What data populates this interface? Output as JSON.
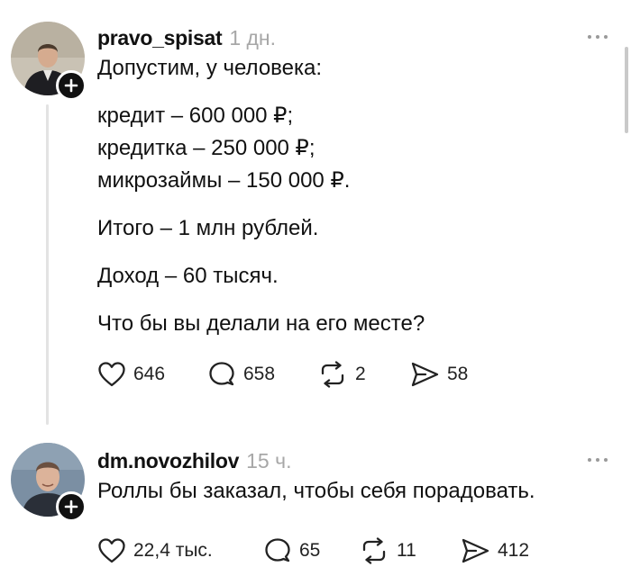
{
  "posts": [
    {
      "username": "pravo_spisat",
      "timestamp": "1 дн.",
      "lines": [
        "Допустим, у человека:",
        "",
        "кредит – 600 000 ₽;",
        "кредитка – 250 000 ₽;",
        "микрозаймы – 150 000 ₽.",
        "",
        "Итого – 1 млн рублей.",
        "",
        "Доход – 60 тысяч.",
        "",
        "Что бы вы делали на его месте?"
      ],
      "likes": "646",
      "replies": "658",
      "reposts": "2",
      "shares": "58"
    },
    {
      "username": "dm.novozhilov",
      "timestamp": "15 ч.",
      "lines": [
        "Роллы бы заказал, чтобы себя порадовать."
      ],
      "likes": "22,4 тыс.",
      "replies": "65",
      "reposts": "11",
      "shares": "412"
    }
  ],
  "icons": [
    "heart-icon",
    "comment-icon",
    "repost-icon",
    "share-icon",
    "plus-icon",
    "more-icon"
  ],
  "colors": {
    "text": "#111111",
    "muted": "#a7a7a7",
    "thread_line": "#e3e3e3"
  }
}
